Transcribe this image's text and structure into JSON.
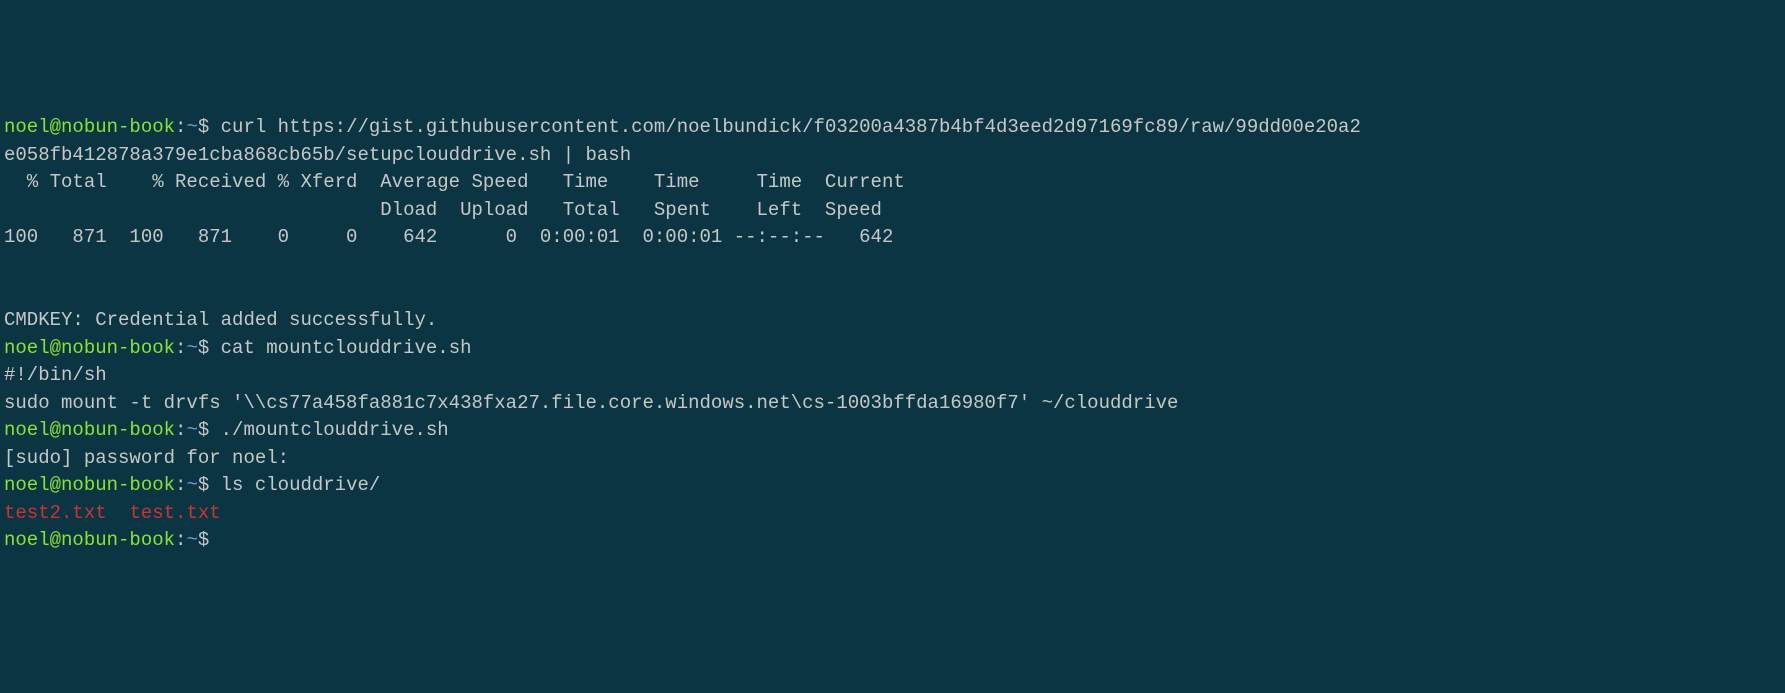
{
  "lines": {
    "l1_user": "noel@nobun-book",
    "l1_colon": ":",
    "l1_path": "~",
    "l1_dollar": "$ ",
    "l1_cmd": "curl https://gist.githubusercontent.com/noelbundick/f03200a4387b4bf4d3eed2d97169fc89/raw/99dd00e20a2",
    "l2_cmd": "e058fb412878a379e1cba868cb65b/setupclouddrive.sh | bash",
    "l3": "  % Total    % Received % Xferd  Average Speed   Time    Time     Time  Current",
    "l4": "                                 Dload  Upload   Total   Spent    Left  Speed",
    "l5": "100   871  100   871    0     0    642      0  0:00:01  0:00:01 --:--:--   642",
    "l6": "",
    "l7": "",
    "l8": "CMDKEY: Credential added successfully.",
    "l9_user": "noel@nobun-book",
    "l9_colon": ":",
    "l9_path": "~",
    "l9_dollar": "$ ",
    "l9_cmd": "cat mountclouddrive.sh",
    "l10": "#!/bin/sh",
    "l11": "sudo mount -t drvfs '\\\\cs77a458fa881c7x438fxa27.file.core.windows.net\\cs-1003bffda16980f7' ~/clouddrive",
    "l12_user": "noel@nobun-book",
    "l12_colon": ":",
    "l12_path": "~",
    "l12_dollar": "$ ",
    "l12_cmd": "./mountclouddrive.sh",
    "l13": "[sudo] password for noel:",
    "l14_user": "noel@nobun-book",
    "l14_colon": ":",
    "l14_path": "~",
    "l14_dollar": "$ ",
    "l14_cmd": "ls clouddrive/",
    "l15_f1": "test2.txt",
    "l15_sep": "  ",
    "l15_f2": "test.txt",
    "l16_user": "noel@nobun-book",
    "l16_colon": ":",
    "l16_path": "~",
    "l16_dollar": "$"
  }
}
